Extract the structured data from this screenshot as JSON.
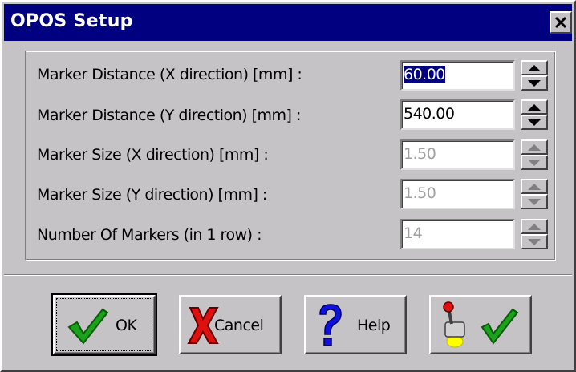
{
  "window": {
    "title": "OPOS Setup",
    "close_glyph": "×"
  },
  "rows": [
    {
      "label": "Marker Distance (X direction) [mm] :",
      "value": "60.00",
      "enabled": true,
      "selected": true
    },
    {
      "label": "Marker Distance (Y direction) [mm] :",
      "value": "540.00",
      "enabled": true,
      "selected": false
    },
    {
      "label": "Marker Size (X direction) [mm] :",
      "value": "1.50",
      "enabled": false,
      "selected": false
    },
    {
      "label": "Marker Size (Y direction) [mm] :",
      "value": "1.50",
      "enabled": false,
      "selected": false
    },
    {
      "label": "Number Of Markers (in 1 row) :",
      "value": "14",
      "enabled": false,
      "selected": false
    }
  ],
  "buttons": {
    "ok": {
      "label": "OK",
      "icon": "checkmark-icon"
    },
    "cancel": {
      "label": "Cancel",
      "icon": "red-x-icon"
    },
    "help": {
      "label": "Help",
      "icon": "question-mark-icon"
    },
    "test": {
      "label": "",
      "icon": "joystick-check-icon"
    }
  },
  "colors": {
    "title_bar": "#000080",
    "face": "#c6c3c6",
    "check_green": "#1aa31a",
    "cancel_red": "#e01010",
    "help_blue": "#1010e0",
    "disabled_text": "#a0a0a0"
  }
}
